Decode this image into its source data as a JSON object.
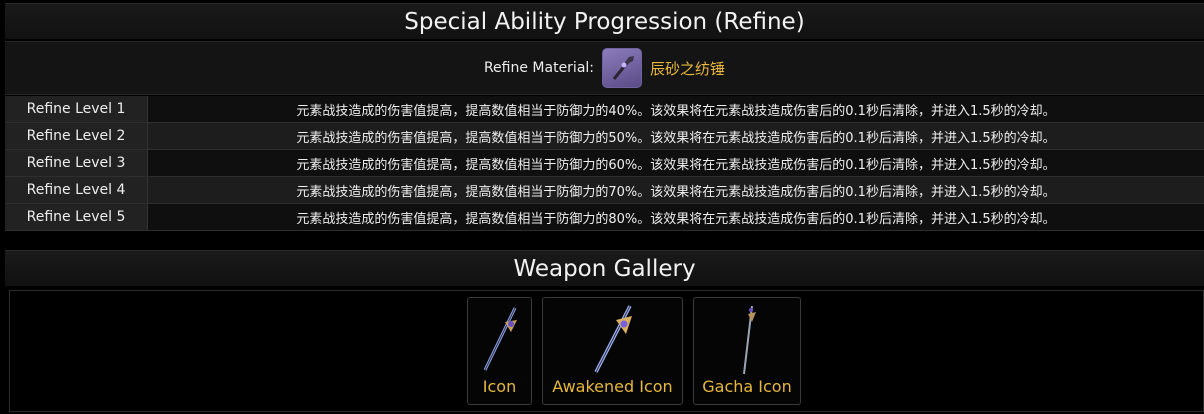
{
  "refine": {
    "title": "Special Ability Progression (Refine)",
    "material_label": "Refine Material:",
    "material_name": "辰砂之纺锤",
    "levels": [
      {
        "label": "Refine Level 1",
        "desc": "元素战技造成的伤害值提高，提高数值相当于防御力的40%。该效果将在元素战技造成伤害后的0.1秒后清除，并进入1.5秒的冷却。"
      },
      {
        "label": "Refine Level 2",
        "desc": "元素战技造成的伤害值提高，提高数值相当于防御力的50%。该效果将在元素战技造成伤害后的0.1秒后清除，并进入1.5秒的冷却。"
      },
      {
        "label": "Refine Level 3",
        "desc": "元素战技造成的伤害值提高，提高数值相当于防御力的60%。该效果将在元素战技造成伤害后的0.1秒后清除，并进入1.5秒的冷却。"
      },
      {
        "label": "Refine Level 4",
        "desc": "元素战技造成的伤害值提高，提高数值相当于防御力的70%。该效果将在元素战技造成伤害后的0.1秒后清除，并进入1.5秒的冷却。"
      },
      {
        "label": "Refine Level 5",
        "desc": "元素战技造成的伤害值提高，提高数值相当于防御力的80%。该效果将在元素战技造成伤害后的0.1秒后清除，并进入1.5秒的冷却。"
      }
    ]
  },
  "gallery": {
    "title": "Weapon Gallery",
    "items": [
      {
        "label": "Icon",
        "icon": "sword-icon"
      },
      {
        "label": "Awakened Icon",
        "icon": "awakened-sword-icon"
      },
      {
        "label": "Gacha Icon",
        "icon": "gacha-sword-icon"
      }
    ]
  },
  "colors": {
    "accent": "#e8b83c",
    "material_bg": "#7a6bb0"
  }
}
